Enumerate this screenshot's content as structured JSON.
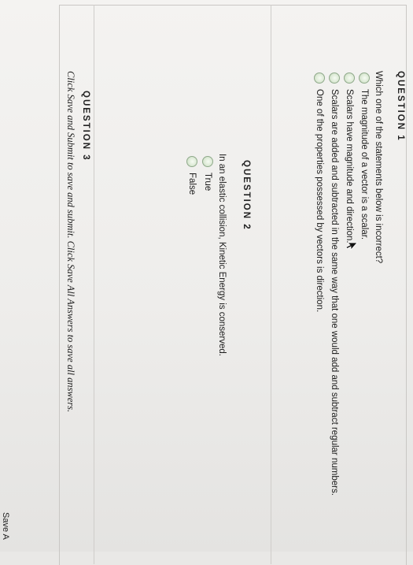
{
  "questions": [
    {
      "header": "QUESTION 1",
      "prompt": "Which one of the statements below is incorrect?",
      "options": [
        "The magnitude of a vector is a scalar.",
        "Scalars have magnitude and direction.",
        "Scalars are added and subtracted in the same way that one would add and subtract regular numbers.",
        "One of the properties possessed by vectors is direction."
      ]
    },
    {
      "header": "QUESTION 2",
      "prompt": "In an elastic collision, Kinetic Energy is conserved.",
      "options": [
        "True",
        "False"
      ]
    },
    {
      "header": "QUESTION 3"
    }
  ],
  "footer": {
    "instructions": "Click Save and Submit to save and submit. Click Save All Answers to save all answers.",
    "save_button": "Save A"
  },
  "colors": {
    "radio": "#dbe9d4",
    "background": "#f4f3f1"
  },
  "icons": {
    "cursor": "arrow-cursor-icon"
  }
}
